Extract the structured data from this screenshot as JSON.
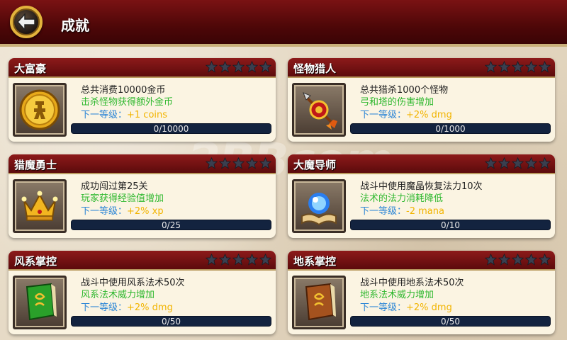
{
  "header": {
    "title": "成就",
    "back_icon": "back-arrow-icon"
  },
  "watermark": {
    "text1": "2BBcom",
    "text2": "掌游网"
  },
  "achievements": [
    {
      "id": "rich",
      "name": "大富豪",
      "stars_filled": 0,
      "stars_total": 5,
      "desc": "总共消费10000金币",
      "effect": "击杀怪物获得额外金币",
      "next_label": "下一等级：",
      "next_value": "+1  coins",
      "progress": "0/10000",
      "icon": "gold-coin-icon"
    },
    {
      "id": "hunter",
      "name": "怪物猎人",
      "stars_filled": 0,
      "stars_total": 5,
      "desc": "总共猎杀1000个怪物",
      "effect": "弓和塔的伤害增加",
      "next_label": "下一等级：",
      "next_value": "+2%  dmg",
      "progress": "0/1000",
      "icon": "arrow-target-icon"
    },
    {
      "id": "demonhunter",
      "name": "猎魔勇士",
      "stars_filled": 0,
      "stars_total": 5,
      "desc": "成功闯过第25关",
      "effect": "玩家获得经验值增加",
      "next_label": "下一等级：",
      "next_value": "+2%  xp",
      "progress": "0/25",
      "icon": "crown-icon"
    },
    {
      "id": "mage",
      "name": "大魔导师",
      "stars_filled": 0,
      "stars_total": 5,
      "desc": "战斗中使用魔晶恢复法力10次",
      "effect": "法术的法力消耗降低",
      "next_label": "下一等级：",
      "next_value": "-2  mana",
      "progress": "0/10",
      "icon": "crystal-book-icon"
    },
    {
      "id": "wind",
      "name": "风系掌控",
      "stars_filled": 0,
      "stars_total": 5,
      "desc": "战斗中使用风系法术50次",
      "effect": "风系法术威力增加",
      "next_label": "下一等级：",
      "next_value": "+2%  dmg",
      "progress": "0/50",
      "icon": "green-spellbook-icon"
    },
    {
      "id": "earth",
      "name": "地系掌控",
      "stars_filled": 0,
      "stars_total": 5,
      "desc": "战斗中使用地系法术50次",
      "effect": "地系法术威力增加",
      "next_label": "下一等级：",
      "next_value": "+2%  dmg",
      "progress": "0/50",
      "icon": "brown-spellbook-icon"
    }
  ]
}
